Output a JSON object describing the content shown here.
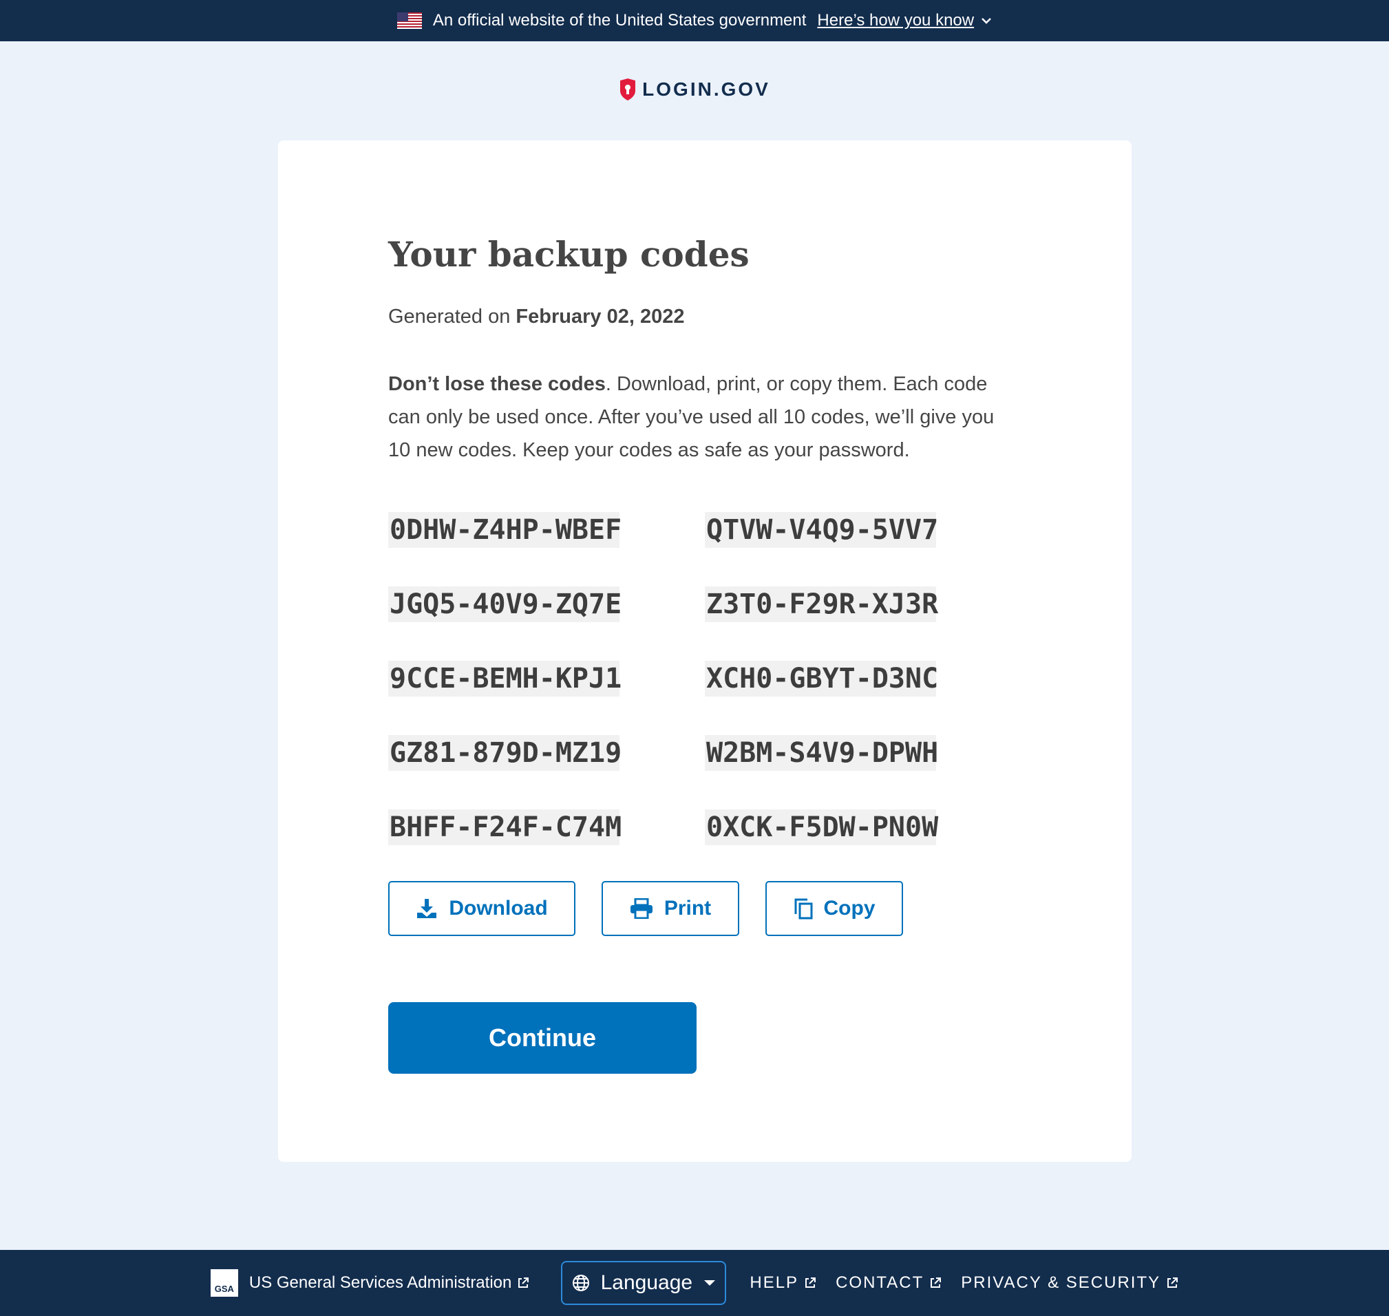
{
  "banner": {
    "official_text": "An official website of the United States government",
    "how_link": "Here’s how you know"
  },
  "logo": {
    "text": "LOGIN.GOV"
  },
  "page": {
    "title": "Your backup codes",
    "generated_prefix": "Generated on",
    "generated_date": "February 02, 2022",
    "warning_bold": "Don’t lose these codes",
    "warning_rest": ". Download, print, or copy them. Each code can only be used once. After you’ve used all 10 codes, we’ll give you 10 new codes. Keep your codes as safe as your password."
  },
  "codes": [
    "0DHW-Z4HP-WBEF",
    "QTVW-V4Q9-5VV7",
    "JGQ5-40V9-ZQ7E",
    "Z3T0-F29R-XJ3R",
    "9CCE-BEMH-KPJ1",
    "XCH0-GBYT-D3NC",
    "GZ81-879D-MZ19",
    "W2BM-S4V9-DPWH",
    "BHFF-F24F-C74M",
    "0XCK-F5DW-PN0W"
  ],
  "actions": {
    "download": "Download",
    "print": "Print",
    "copy": "Copy",
    "continue": "Continue"
  },
  "footer": {
    "gsa_logo": "GSA",
    "gsa": "US General Services Administration",
    "language": "Language",
    "help": "HELP",
    "contact": "CONTACT",
    "privacy": "PRIVACY & SECURITY"
  },
  "colors": {
    "navy": "#132d4d",
    "primary": "#0071bb",
    "background": "#ebf2fa",
    "shield_red": "#e21c3d"
  }
}
